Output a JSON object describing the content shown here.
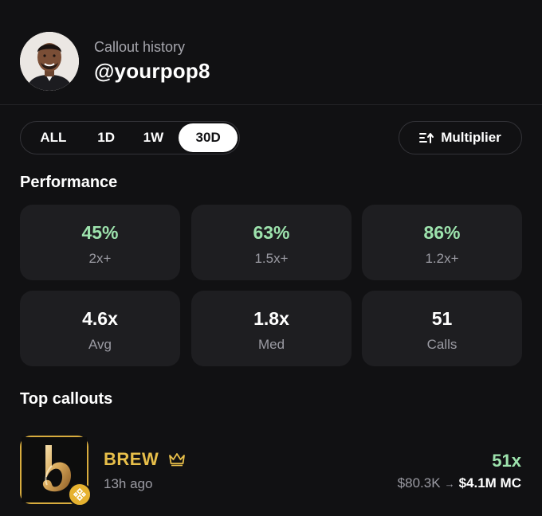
{
  "profile": {
    "subtitle": "Callout history",
    "handle": "@yourpop8"
  },
  "range_tabs": [
    {
      "label": "ALL",
      "active": false
    },
    {
      "label": "1D",
      "active": false
    },
    {
      "label": "1W",
      "active": false
    },
    {
      "label": "30D",
      "active": true
    }
  ],
  "multiplier_button": {
    "label": "Multiplier",
    "icon": "sort-icon"
  },
  "performance": {
    "title": "Performance",
    "cards": [
      {
        "value": "45%",
        "label": "2x+",
        "color": "#9de3ad"
      },
      {
        "value": "63%",
        "label": "1.5x+",
        "color": "#9de3ad"
      },
      {
        "value": "86%",
        "label": "1.2x+",
        "color": "#9de3ad"
      },
      {
        "value": "4.6x",
        "label": "Avg",
        "color": "#ffffff"
      },
      {
        "value": "1.8x",
        "label": "Med",
        "color": "#ffffff"
      },
      {
        "value": "51",
        "label": "Calls",
        "color": "#ffffff"
      }
    ]
  },
  "top_callouts": {
    "title": "Top callouts",
    "items": [
      {
        "name": "BREW",
        "time": "13h ago",
        "multiplier": "51x",
        "mc_from": "$80.3K",
        "arrow": "→",
        "mc_to": "$4.1M",
        "mc_unit": "MC",
        "icons": [
          "brew-token-logo",
          "bnb-chain-icon",
          "crown-icon"
        ]
      }
    ]
  },
  "colors": {
    "background": "#111113",
    "card": "#1e1e21",
    "positive": "#9de3ad",
    "gold": "#e8bf4a",
    "muted": "#9b9ba3"
  }
}
